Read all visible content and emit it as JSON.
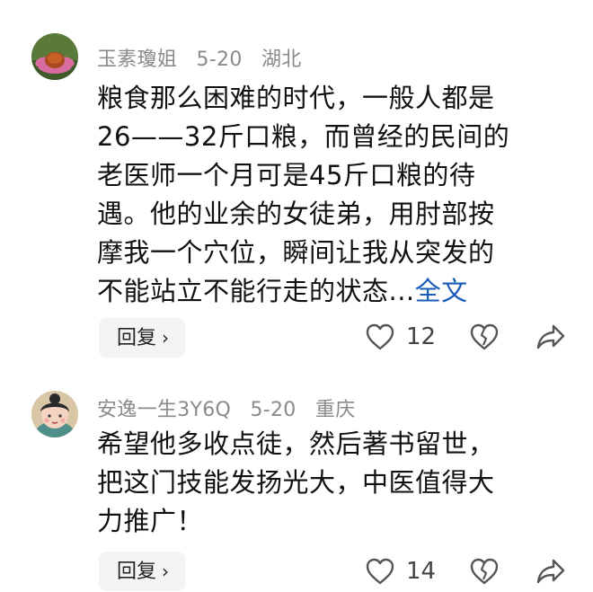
{
  "comments": [
    {
      "user": "玉素瓊姐",
      "date": "5-20",
      "location": "湖北",
      "lines": [
        "粮食那么困难的时代，一般人都是",
        "26——32斤口粮，而曾经的民间的",
        "老医师一个月可是45斤口粮的待",
        "遇。他的业余的女徒弟，用肘部按",
        "摩我一个穴位，瞬间让我从突发的"
      ],
      "last_line": "不能站立不能行走的状态...",
      "full_link": "全文",
      "reply_label": "回复",
      "likes": "12"
    },
    {
      "user": "安逸一生3Y6Q",
      "date": "5-20",
      "location": "重庆",
      "lines": [
        "希望他多收点徒，然后著书留世，",
        "把这门技能发扬光大，中医值得大",
        "力推广！"
      ],
      "reply_label": "回复",
      "likes": "14"
    }
  ],
  "icons": {
    "like": "heart-outline-icon",
    "dislike": "broken-heart-icon",
    "share": "share-arrow-icon",
    "reply_chevron": "chevron-right-icon"
  },
  "colors": {
    "link": "#1a5bb8",
    "meta": "#8a8a8a",
    "reply_bg": "#f4f4f4"
  }
}
